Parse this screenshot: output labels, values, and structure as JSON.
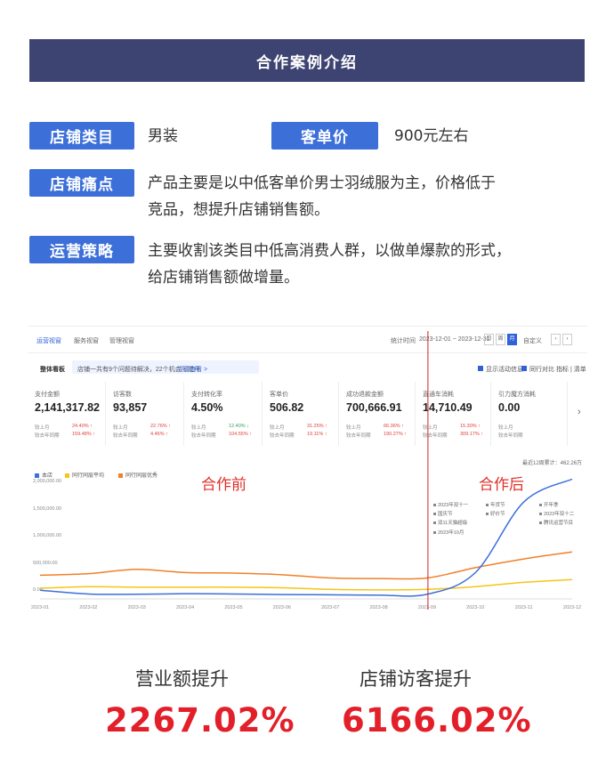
{
  "header": {
    "title": "合作案例介绍"
  },
  "info": {
    "category_tag": "店铺类目",
    "category_value": "男装",
    "price_tag": "客单价",
    "price_value": "900元左右",
    "pain_tag": "店铺痛点",
    "pain_line1": "产品主要是以中低客单价男士羽绒服为主，价格低于",
    "pain_line2": "竞品，想提升店铺销售额。",
    "strategy_tag": "运营策略",
    "strategy_line1": "主要收割该类目中低高消费人群，以做单爆款的形式，",
    "strategy_line2": "给店铺销售额做增量。"
  },
  "dashboard": {
    "tabs": [
      "运营视窗",
      "服务视窗",
      "管理视窗"
    ],
    "date_label": "统计时间",
    "date_range": "2023-12-01 ~ 2023-12-31",
    "period_buttons": [
      "日",
      "周",
      "月"
    ],
    "custom_label": "自定义",
    "section_title": "整体看板",
    "notice_text": "店铺一共有9个问题待解决，22个机会可提升",
    "notice_link": "立即查看 >",
    "compare_options": [
      "显示活动信息",
      "同行对比"
    ],
    "setting_text": "指标 | 清单",
    "kpis": [
      {
        "label": "支付金额",
        "value": "2,141,317.82",
        "r1": "较上月",
        "p1": "24.40%",
        "r2": "较去年同期",
        "p2": "159.48%",
        "d1": false
      },
      {
        "label": "访客数",
        "value": "93,857",
        "r1": "较上月",
        "p1": "22.76%",
        "r2": "较去年同期",
        "p2": "4.46%",
        "d1": false
      },
      {
        "label": "支付转化率",
        "value": "4.50%",
        "r1": "较上月",
        "p1": "12.40%",
        "r2": "较去年同期",
        "p2": "104.55%",
        "d1": true
      },
      {
        "label": "客单价",
        "value": "506.82",
        "r1": "较上月",
        "p1": "31.25%",
        "r2": "较去年同期",
        "p2": "19.11%",
        "d1": false
      },
      {
        "label": "成功退款金额",
        "value": "700,666.91",
        "r1": "较上月",
        "p1": "66.36%",
        "r2": "较去年同期",
        "p2": "190.27%",
        "d1": false
      },
      {
        "label": "直通车消耗",
        "value": "14,710.49",
        "r1": "较上月",
        "p1": "15.30%",
        "r2": "较去年同期",
        "p2": "309.17%",
        "d1": false
      },
      {
        "label": "引力魔方消耗",
        "value": "0.00",
        "r1": "较上月",
        "p1": "",
        "r2": "较去年同期",
        "p2": "",
        "d1": false
      }
    ],
    "total_text": "最近12周累计：462.26万",
    "before_label": "合作前",
    "after_label": "合作后",
    "events": [
      "2023年双十一",
      "年货节",
      "开年季",
      "国庆节",
      "好价节",
      "2023年双十二",
      "双11天猫超级",
      "腾讯运营节目",
      "2023年10月"
    ]
  },
  "chart_data": {
    "type": "line",
    "x": [
      "2023-01",
      "2023-02",
      "2023-03",
      "2023-04",
      "2023-05",
      "2023-06",
      "2023-07",
      "2023-08",
      "2023-09",
      "2023-10",
      "2023-11",
      "2023-12"
    ],
    "yticks": [
      "2,000,000.00",
      "1,500,000.00",
      "1,000,000.00",
      "500,000.00",
      "0.00"
    ],
    "ylim": [
      0,
      2000000
    ],
    "series": [
      {
        "name": "本店",
        "color": "#3c6fd8",
        "values": [
          95000,
          25000,
          20000,
          30000,
          25000,
          15000,
          10000,
          5000,
          20000,
          420000,
          1720000,
          2141318
        ]
      },
      {
        "name": "同行同层平均",
        "color": "#f5c518",
        "values": [
          130000,
          160000,
          150000,
          150000,
          150000,
          140000,
          110000,
          100000,
          110000,
          160000,
          240000,
          290000
        ]
      },
      {
        "name": "同行同层优秀",
        "color": "#f0802a",
        "values": [
          370000,
          400000,
          480000,
          420000,
          410000,
          380000,
          320000,
          310000,
          320000,
          510000,
          670000,
          800000
        ]
      }
    ]
  },
  "results": {
    "sales_label": "营业额提升",
    "sales_value": "2267.02%",
    "visitors_label": "店铺访客提升",
    "visitors_value": "6166.02%"
  }
}
